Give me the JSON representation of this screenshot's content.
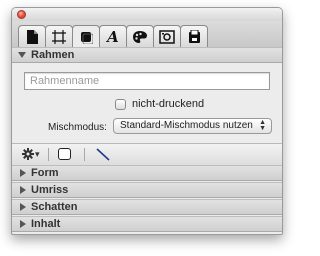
{
  "window": {
    "close_label": ""
  },
  "tabs": [
    {
      "name": "document",
      "icon": "document-icon"
    },
    {
      "name": "frame",
      "icon": "frame-icon"
    },
    {
      "name": "object",
      "icon": "object-icon",
      "active": true
    },
    {
      "name": "text",
      "icon": "text-icon",
      "glyph": "A"
    },
    {
      "name": "color",
      "icon": "palette-icon"
    },
    {
      "name": "image",
      "icon": "image-icon"
    },
    {
      "name": "export",
      "icon": "export-icon"
    }
  ],
  "frame_section": {
    "title": "Rahmen",
    "name_placeholder": "Rahmenname",
    "name_value": "",
    "nonprinting_label": "nicht-druckend",
    "blend_mode_label": "Mischmodus:",
    "blend_mode_value": "Standard-Mischmodus nutzen",
    "blend_mode_arrows": "▲\n▼"
  },
  "toolbar": {
    "gear_icon": "gear-icon",
    "menu_arrow": "▾"
  },
  "collapsed_sections": [
    {
      "title": "Form"
    },
    {
      "title": "Umriss"
    },
    {
      "title": "Schatten"
    },
    {
      "title": "Inhalt"
    }
  ]
}
